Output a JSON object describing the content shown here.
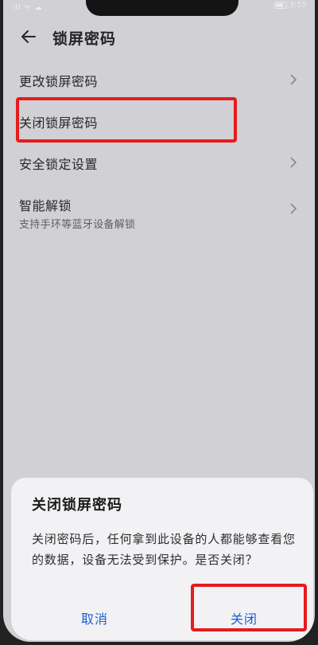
{
  "status_bar": {
    "left_icons": "ıll ᯤ ☁",
    "time": "3:55"
  },
  "header": {
    "title": "锁屏密码"
  },
  "settings": [
    {
      "label": "更改锁屏密码",
      "has_chevron": true
    },
    {
      "label": "关闭锁屏密码",
      "has_chevron": false
    },
    {
      "label": "安全锁定设置",
      "has_chevron": true
    },
    {
      "label": "智能解锁",
      "sub": "支持手环等蓝牙设备解锁",
      "has_chevron": true
    }
  ],
  "dialog": {
    "title": "关闭锁屏密码",
    "message": "关闭密码后，任何拿到此设备的人都能够查看您的数据，设备无法受到保护。是否关闭？",
    "cancel_label": "取消",
    "confirm_label": "关闭"
  },
  "colors": {
    "accent": "#1a5fd0",
    "highlight": "#e51c1c",
    "background": "#d9d8dc",
    "dialog_bg": "#f2f1f4"
  }
}
